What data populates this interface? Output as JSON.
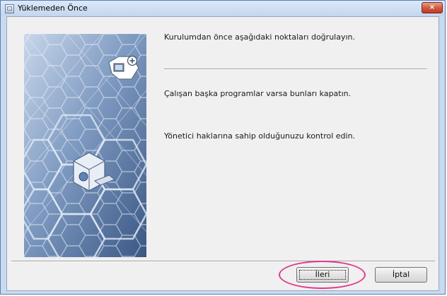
{
  "window": {
    "title": "Yüklemeden Önce",
    "close_glyph": "×"
  },
  "messages": {
    "intro": "Kurulumdan önce aşağıdaki noktaları doğrulayın.",
    "close_programs": "Çalışan başka programlar varsa bunları kapatın.",
    "admin_rights": "Yönetici haklarına sahip olduğunuzu kontrol edin."
  },
  "buttons": {
    "next": "İleri",
    "cancel": "İptal"
  },
  "colors": {
    "banner_blue": "#4f6f9a",
    "highlight": "#e03a8c"
  },
  "icons": {
    "top": "computer-add-icon",
    "middle": "install-cube-icon"
  }
}
